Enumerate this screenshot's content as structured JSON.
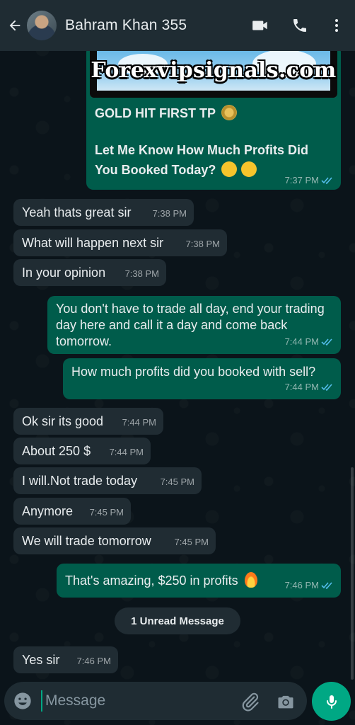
{
  "header": {
    "contact_name": "Bahram Khan 355",
    "icons": [
      "back-arrow-icon",
      "video-call-icon",
      "voice-call-icon",
      "more-options-icon"
    ]
  },
  "image_message": {
    "brand_text": "Forexvipsignals.com",
    "line1": "GOLD HIT FIRST TP",
    "line2": "Let Me Know How Much Profits Did You Booked Today?",
    "time": "7:37 PM"
  },
  "messages": [
    {
      "dir": "in",
      "text": "Yeah thats great sir",
      "time": "7:38 PM"
    },
    {
      "dir": "in",
      "text": "What will happen next sir",
      "time": "7:38 PM"
    },
    {
      "dir": "in",
      "text": "In your opinion",
      "time": "7:38 PM"
    },
    {
      "dir": "out",
      "text": "You don't have to trade all day, end your trading day here and call it a day and come back tomorrow.",
      "time": "7:44 PM"
    },
    {
      "dir": "out",
      "text": "How much profits did you booked with sell?",
      "time": "7:44 PM"
    },
    {
      "dir": "in",
      "text": "Ok sir its good",
      "time": "7:44 PM"
    },
    {
      "dir": "in",
      "text": "About 250 $",
      "time": "7:44 PM"
    },
    {
      "dir": "in",
      "text": "I will.Not trade today",
      "time": "7:45 PM"
    },
    {
      "dir": "in",
      "text": "Anymore",
      "time": "7:45 PM"
    },
    {
      "dir": "in",
      "text": "We will trade tomorrow",
      "time": "7:45 PM"
    },
    {
      "dir": "out",
      "text": "That's amazing, $250 in profits",
      "time": "7:46 PM"
    },
    {
      "dir": "in",
      "text": "Yes sir",
      "time": "7:46 PM"
    }
  ],
  "unread_label": "1 Unread Message",
  "composer": {
    "placeholder": "Message"
  },
  "colors": {
    "header_bg": "#1f2c33",
    "incoming_bubble": "#202c33",
    "outgoing_bubble": "#005c4b",
    "accent": "#00a884",
    "read_tick": "#53bdeb"
  }
}
